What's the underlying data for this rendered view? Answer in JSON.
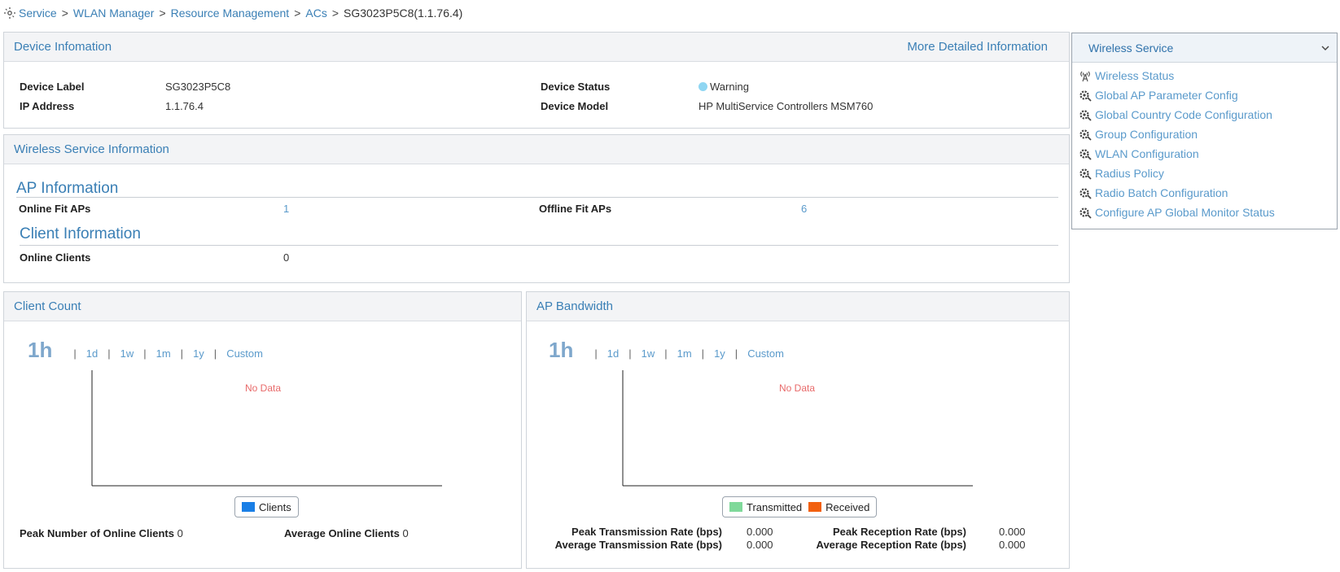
{
  "breadcrumb": {
    "items": [
      "Service",
      "WLAN Manager",
      "Resource Management",
      "ACs"
    ],
    "current": "SG3023P5C8(1.1.76.4)",
    "separator": ">"
  },
  "device_info": {
    "title": "Device Infomation",
    "more_link": "More Detailed Information",
    "label_key": "Device Label",
    "label_val": "SG3023P5C8",
    "ip_key": "IP Address",
    "ip_val": "1.1.76.4",
    "status_key": "Device Status",
    "status_val": "Warning",
    "model_key": "Device Model",
    "model_val": "HP MultiService Controllers MSM760",
    "status_color": "#8fd6f2"
  },
  "wireless_info": {
    "title": "Wireless Service Information",
    "ap_section": "AP Information",
    "online_aps_key": "Online Fit APs",
    "online_aps_val": "1",
    "offline_aps_key": "Offline Fit APs",
    "offline_aps_val": "6",
    "client_section": "Client Information",
    "online_clients_key": "Online Clients",
    "online_clients_val": "0"
  },
  "side_menu": {
    "title": "Wireless Service",
    "items": [
      {
        "label": "Wireless Status",
        "icon": "antenna-icon"
      },
      {
        "label": "Global AP Parameter Config",
        "icon": "config-gear-icon"
      },
      {
        "label": "Global Country Code Configuration",
        "icon": "config-gear-icon"
      },
      {
        "label": "Group Configuration",
        "icon": "config-gear-icon"
      },
      {
        "label": "WLAN Configuration",
        "icon": "config-gear-icon"
      },
      {
        "label": "Radius Policy",
        "icon": "config-gear-icon"
      },
      {
        "label": "Radio Batch Configuration",
        "icon": "config-gear-icon"
      },
      {
        "label": "Configure AP Global Monitor Status",
        "icon": "config-gear-icon"
      }
    ]
  },
  "client_count": {
    "title": "Client Count",
    "range_selected": "1h",
    "range_options": [
      "1d",
      "1w",
      "1m",
      "1y",
      "Custom"
    ],
    "no_data": "No Data",
    "legend": [
      {
        "name": "Clients",
        "color": "#1a7fe6"
      }
    ],
    "peak_key": "Peak Number of Online Clients",
    "peak_val": "0",
    "avg_key": "Average Online Clients",
    "avg_val": "0"
  },
  "ap_bandwidth": {
    "title": "AP Bandwidth",
    "range_selected": "1h",
    "range_options": [
      "1d",
      "1w",
      "1m",
      "1y",
      "Custom"
    ],
    "no_data": "No Data",
    "legend": [
      {
        "name": "Transmitted",
        "color": "#7fd99a"
      },
      {
        "name": "Received",
        "color": "#f2600f"
      }
    ],
    "peak_tx_key": "Peak Transmission Rate (bps)",
    "peak_tx_val": "0.000",
    "avg_tx_key": "Average Transmission Rate (bps)",
    "avg_tx_val": "0.000",
    "peak_rx_key": "Peak Reception Rate (bps)",
    "peak_rx_val": "0.000",
    "avg_rx_key": "Average Reception Rate (bps)",
    "avg_rx_val": "0.000"
  },
  "colors": {
    "accent": "#3a7fb5",
    "no_data": "#e86a6a"
  }
}
